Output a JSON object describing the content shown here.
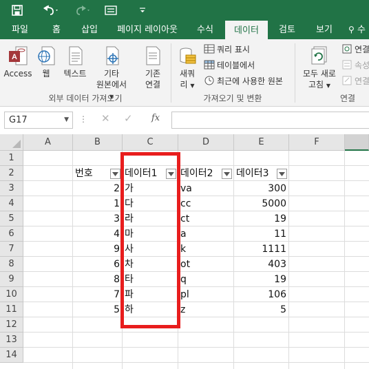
{
  "tabs": [
    {
      "label": "파일"
    },
    {
      "label": "홈"
    },
    {
      "label": "삽입"
    },
    {
      "label": "페이지 레이아웃"
    },
    {
      "label": "수식"
    },
    {
      "label": "데이터"
    },
    {
      "label": "검토"
    },
    {
      "label": "보기"
    },
    {
      "label": "수"
    }
  ],
  "active_tab": "데이터",
  "ribbon": {
    "access": "Access",
    "web": "웹",
    "text": "텍스트",
    "other_sources_l1": "기타",
    "other_sources_l2": "원본에서",
    "existing_l1": "기존",
    "existing_l2": "연결",
    "new_query_l1": "새쿼",
    "new_query_l2": "리",
    "show_queries": "쿼리 표시",
    "from_table": "테이블에서",
    "recent_sources": "최근에 사용한 원본",
    "refresh_l1": "모두 새로",
    "refresh_l2": "고침",
    "connections": "연결",
    "properties": "속성",
    "edit_links": "연결",
    "group_external": "외부 데이터 가져오기",
    "group_get_transform": "가져오기 및 변환",
    "group_connections": "연결"
  },
  "formula_bar": {
    "name_box": "G17",
    "fx": "fx",
    "value": ""
  },
  "columns": [
    "A",
    "B",
    "C",
    "D",
    "E",
    "F"
  ],
  "rows": [
    "1",
    "2",
    "3",
    "4",
    "5",
    "6",
    "7",
    "8",
    "9",
    "10",
    "11",
    "12",
    "13",
    "14"
  ],
  "table": {
    "headers": [
      "번호",
      "데이터1",
      "데이터2",
      "데이터3"
    ],
    "rows": [
      [
        "2",
        "가",
        "va",
        "300"
      ],
      [
        "1",
        "다",
        "cc",
        "5000"
      ],
      [
        "3",
        "라",
        "ct",
        "19"
      ],
      [
        "4",
        "마",
        "a",
        "11"
      ],
      [
        "9",
        "사",
        "k",
        "1111"
      ],
      [
        "6",
        "차",
        "ot",
        "403"
      ],
      [
        "8",
        "타",
        "q",
        "19"
      ],
      [
        "7",
        "파",
        "pl",
        "106"
      ],
      [
        "5",
        "하",
        "z",
        "5"
      ]
    ]
  },
  "colors": {
    "excel_green": "#217346",
    "highlight": "#e81d1d"
  }
}
